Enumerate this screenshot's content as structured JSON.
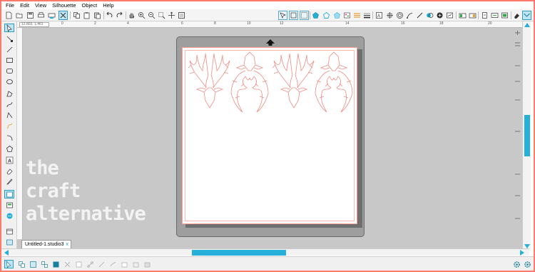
{
  "menu": [
    "File",
    "Edit",
    "View",
    "Silhouette",
    "Object",
    "Help"
  ],
  "ruler": {
    "coord_readout": "12.803, 1.461",
    "labels": [
      "0",
      "2",
      "4",
      "6",
      "8",
      "10",
      "12",
      "14",
      "16",
      "18",
      "20"
    ]
  },
  "watermark": {
    "line1": "the",
    "line2": "craft",
    "line3": "alternative"
  },
  "document": {
    "tab_label": "Untitled-1.studio3",
    "tab_close": "x"
  },
  "colors": {
    "accent": "#26b0d9",
    "cut_lines": "#f08c84",
    "frame": "#ff7a6a",
    "mat": "#9e9e9e",
    "workspace": "#c8c8c8"
  },
  "icons": {
    "toolbar_left": [
      "new-icon",
      "open-icon",
      "save-icon",
      "print-icon",
      "send-to-cutter-icon",
      "cut-icon",
      "copy-icon",
      "paste-icon",
      "undo-icon",
      "redo-icon",
      "pan-hand-icon",
      "zoom-in-icon",
      "zoom-out-icon",
      "zoom-select-icon",
      "drag-zoom-icon",
      "fit-to-page-icon"
    ],
    "toolbar_right": [
      "select-all-icon",
      "deselect-icon",
      "group-icon",
      "ungroup-icon",
      "fill-color-icon",
      "line-color-icon",
      "line-style-icon",
      "fill-gradient-icon",
      "fill-pattern-icon",
      "replicate-icon",
      "offset-icon",
      "trace-icon",
      "modify-icon",
      "align-icon",
      "scale-icon",
      "transform-icon",
      "page-setup-icon",
      "registration-icon",
      "send-icon",
      "design-store-icon",
      "library-icon"
    ]
  }
}
